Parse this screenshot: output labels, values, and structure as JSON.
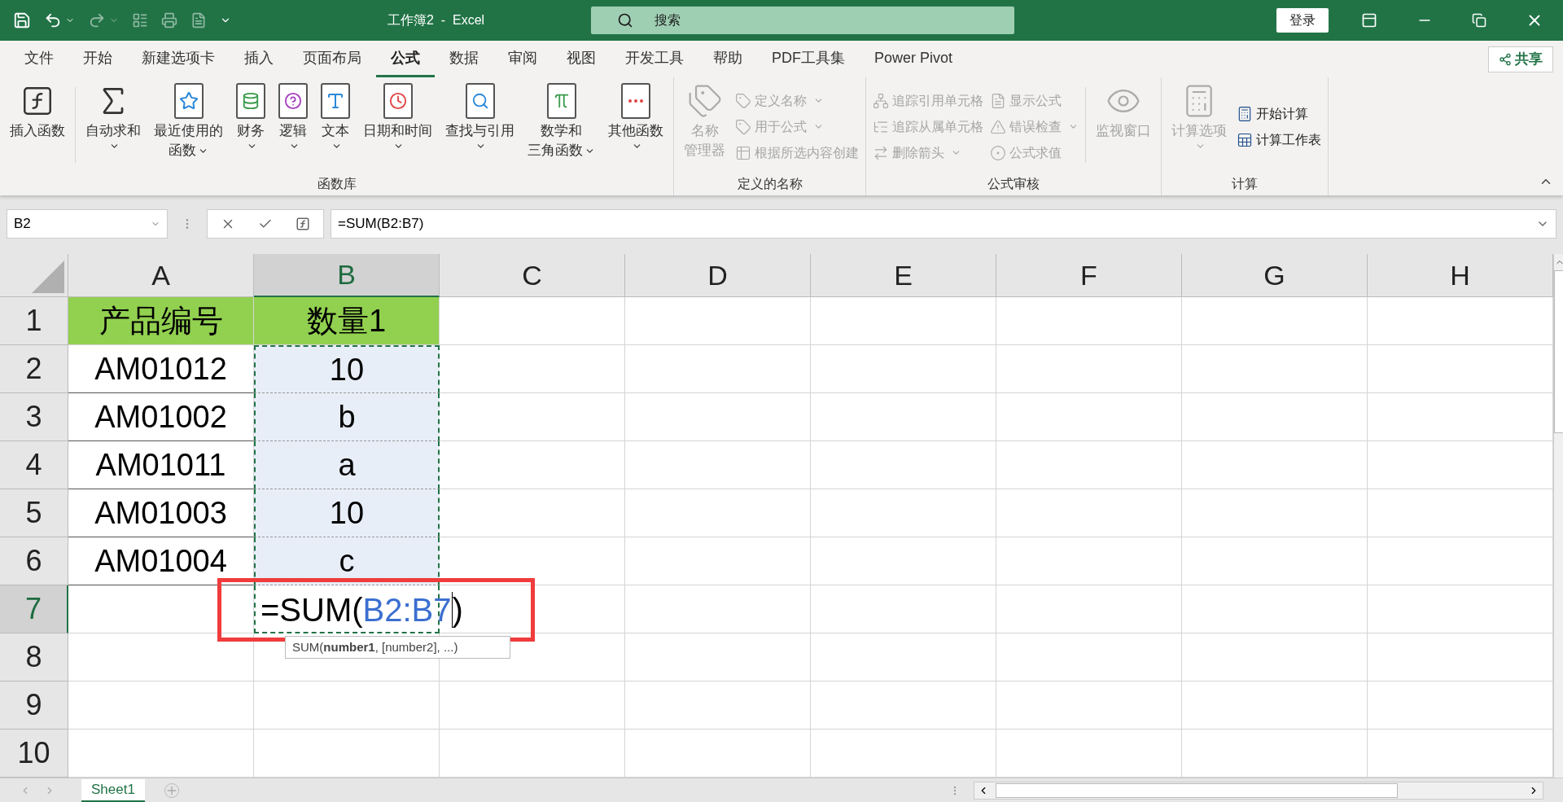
{
  "title_bar": {
    "title": "工作簿2  -  Excel",
    "search": {
      "placeholder": "搜索"
    },
    "login": "登录"
  },
  "menu_tabs": [
    {
      "label": "文件",
      "selected": false
    },
    {
      "label": "开始",
      "selected": false
    },
    {
      "label": "新建选项卡",
      "selected": false
    },
    {
      "label": "插入",
      "selected": false
    },
    {
      "label": "页面布局",
      "selected": false
    },
    {
      "label": "公式",
      "selected": true
    },
    {
      "label": "数据",
      "selected": false
    },
    {
      "label": "审阅",
      "selected": false
    },
    {
      "label": "视图",
      "selected": false
    },
    {
      "label": "开发工具",
      "selected": false
    },
    {
      "label": "帮助",
      "selected": false
    },
    {
      "label": "PDF工具集",
      "selected": false
    },
    {
      "label": "Power Pivot",
      "selected": false
    }
  ],
  "share": "共享",
  "ribbon": {
    "groups": [
      {
        "label": "函数库",
        "items": [
          {
            "kind": "big",
            "lines": [
              "插入函数"
            ],
            "dropdown": false,
            "disabled": false
          },
          {
            "kind": "separator"
          },
          {
            "kind": "big",
            "lines": [
              "自动求和"
            ],
            "dropdown": true,
            "disabled": false
          },
          {
            "kind": "big",
            "lines": [
              "最近使用的",
              "函数"
            ],
            "dropdown": true,
            "disabled": false
          },
          {
            "kind": "big",
            "lines": [
              "财务"
            ],
            "dropdown": true,
            "disabled": false
          },
          {
            "kind": "big",
            "lines": [
              "逻辑"
            ],
            "dropdown": true,
            "disabled": false
          },
          {
            "kind": "big",
            "lines": [
              "文本"
            ],
            "dropdown": true,
            "disabled": false
          },
          {
            "kind": "big",
            "lines": [
              "日期和时间"
            ],
            "dropdown": true,
            "disabled": false
          },
          {
            "kind": "big",
            "lines": [
              "查找与引用"
            ],
            "dropdown": true,
            "disabled": false
          },
          {
            "kind": "big",
            "lines": [
              "数学和",
              "三角函数"
            ],
            "dropdown": true,
            "disabled": false
          },
          {
            "kind": "big",
            "lines": [
              "其他函数"
            ],
            "dropdown": true,
            "disabled": false
          }
        ]
      },
      {
        "label": "定义的名称",
        "items": [
          {
            "kind": "big",
            "lines": [
              "名称",
              "管理器"
            ],
            "dropdown": false,
            "disabled": true
          },
          {
            "kind": "stack",
            "entries": [
              {
                "label": "定义名称",
                "dropdown": true,
                "disabled": true
              },
              {
                "label": "用于公式",
                "dropdown": true,
                "disabled": true
              },
              {
                "label": "根据所选内容创建",
                "dropdown": false,
                "disabled": true
              }
            ]
          }
        ]
      },
      {
        "label": "公式审核",
        "items": [
          {
            "kind": "stack",
            "entries": [
              {
                "label": "追踪引用单元格",
                "dropdown": false,
                "disabled": true
              },
              {
                "label": "追踪从属单元格",
                "dropdown": false,
                "disabled": true
              },
              {
                "label": "删除箭头",
                "dropdown": true,
                "disabled": true
              }
            ]
          },
          {
            "kind": "stack",
            "entries": [
              {
                "label": "显示公式",
                "dropdown": false,
                "disabled": true
              },
              {
                "label": "错误检查",
                "dropdown": true,
                "disabled": true
              },
              {
                "label": "公式求值",
                "dropdown": false,
                "disabled": true
              }
            ]
          },
          {
            "kind": "separator"
          },
          {
            "kind": "big",
            "lines": [
              "监视窗口"
            ],
            "dropdown": false,
            "disabled": true
          }
        ]
      },
      {
        "label": "计算",
        "items": [
          {
            "kind": "big",
            "lines": [
              "计算选项"
            ],
            "dropdown": true,
            "disabled": true
          },
          {
            "kind": "stack",
            "entries": [
              {
                "label": "开始计算",
                "dropdown": false,
                "disabled": false
              },
              {
                "label": "计算工作表",
                "dropdown": false,
                "disabled": false
              }
            ]
          }
        ]
      }
    ]
  },
  "formula_bar": {
    "name_box": "B2",
    "formula": "=SUM(B2:B7)"
  },
  "columns": [
    {
      "label": "A",
      "selected": false
    },
    {
      "label": "B",
      "selected": true
    },
    {
      "label": "C",
      "selected": false
    },
    {
      "label": "D",
      "selected": false
    },
    {
      "label": "E",
      "selected": false
    },
    {
      "label": "F",
      "selected": false
    },
    {
      "label": "G",
      "selected": false
    },
    {
      "label": "H",
      "selected": false
    }
  ],
  "rows": [
    {
      "number": "1",
      "selected": false,
      "cells": [
        {
          "kind": "header",
          "text": "产品编号",
          "in_range": false
        },
        {
          "kind": "header",
          "text": "数量1",
          "in_range": false
        }
      ]
    },
    {
      "number": "2",
      "selected": false,
      "cells": [
        {
          "kind": "text",
          "text": "AM01012",
          "in_range": false
        },
        {
          "kind": "text",
          "text": "10",
          "in_range": true
        }
      ]
    },
    {
      "number": "3",
      "selected": false,
      "cells": [
        {
          "kind": "text",
          "text": "AM01002",
          "in_range": false
        },
        {
          "kind": "text",
          "text": "b",
          "in_range": true
        }
      ]
    },
    {
      "number": "4",
      "selected": false,
      "cells": [
        {
          "kind": "text",
          "text": "AM01011",
          "in_range": false
        },
        {
          "kind": "text",
          "text": "a",
          "in_range": true
        }
      ]
    },
    {
      "number": "5",
      "selected": false,
      "cells": [
        {
          "kind": "text",
          "text": "AM01003",
          "in_range": false
        },
        {
          "kind": "text",
          "text": "10",
          "in_range": true
        }
      ]
    },
    {
      "number": "6",
      "selected": false,
      "cells": [
        {
          "kind": "text",
          "text": "AM01004",
          "in_range": false
        },
        {
          "kind": "text",
          "text": "c",
          "in_range": true
        }
      ]
    },
    {
      "number": "7",
      "selected": true,
      "cells": [
        {
          "kind": "empty",
          "in_range": false
        },
        {
          "kind": "editing",
          "prefix": "=SUM(",
          "ref": "B2:B7",
          "suffix": ")",
          "in_range": true
        }
      ]
    },
    {
      "number": "8",
      "selected": false
    },
    {
      "number": "9",
      "selected": false
    },
    {
      "number": "10",
      "selected": false
    }
  ],
  "tooltip": "SUM(**number1**, [number2], ...)",
  "sheet_tabs": [
    {
      "label": "Sheet1",
      "selected": true
    }
  ]
}
